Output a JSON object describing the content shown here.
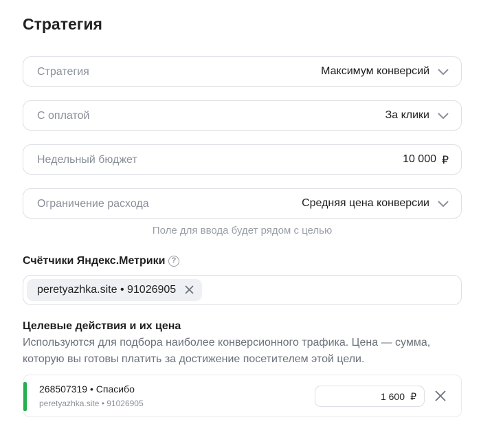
{
  "page": {
    "title": "Стратегия"
  },
  "fields": {
    "strategy": {
      "label": "Стратегия",
      "value": "Максимум конверсий"
    },
    "payment": {
      "label": "С оплатой",
      "value": "За клики"
    },
    "budget": {
      "label": "Недельный бюджет",
      "value": "10 000",
      "currency": "₽"
    },
    "limit": {
      "label": "Ограничение расхода",
      "value": "Средняя цена конверсии"
    }
  },
  "hint": "Поле для ввода будет рядом с целью",
  "counters": {
    "title": "Счётчики Яндекс.Метрики",
    "help": "?",
    "chip": "peretyazhka.site • 91026905"
  },
  "goals": {
    "title": "Целевые действия и их цена",
    "description": "Используются для подбора наиболее конверсионного трафика. Цена — сумма, которую вы готовы платить за достижение посетителем этой цели.",
    "items": [
      {
        "name": "268507319 • Спасибо",
        "site": "peretyazhka.site • 91026905",
        "price": "1 600",
        "currency": "₽",
        "status_color": "#22b14c"
      }
    ]
  },
  "icons": {
    "dropdown": "chevron-down-icon",
    "remove": "close-icon",
    "help": "question-circle-icon"
  }
}
